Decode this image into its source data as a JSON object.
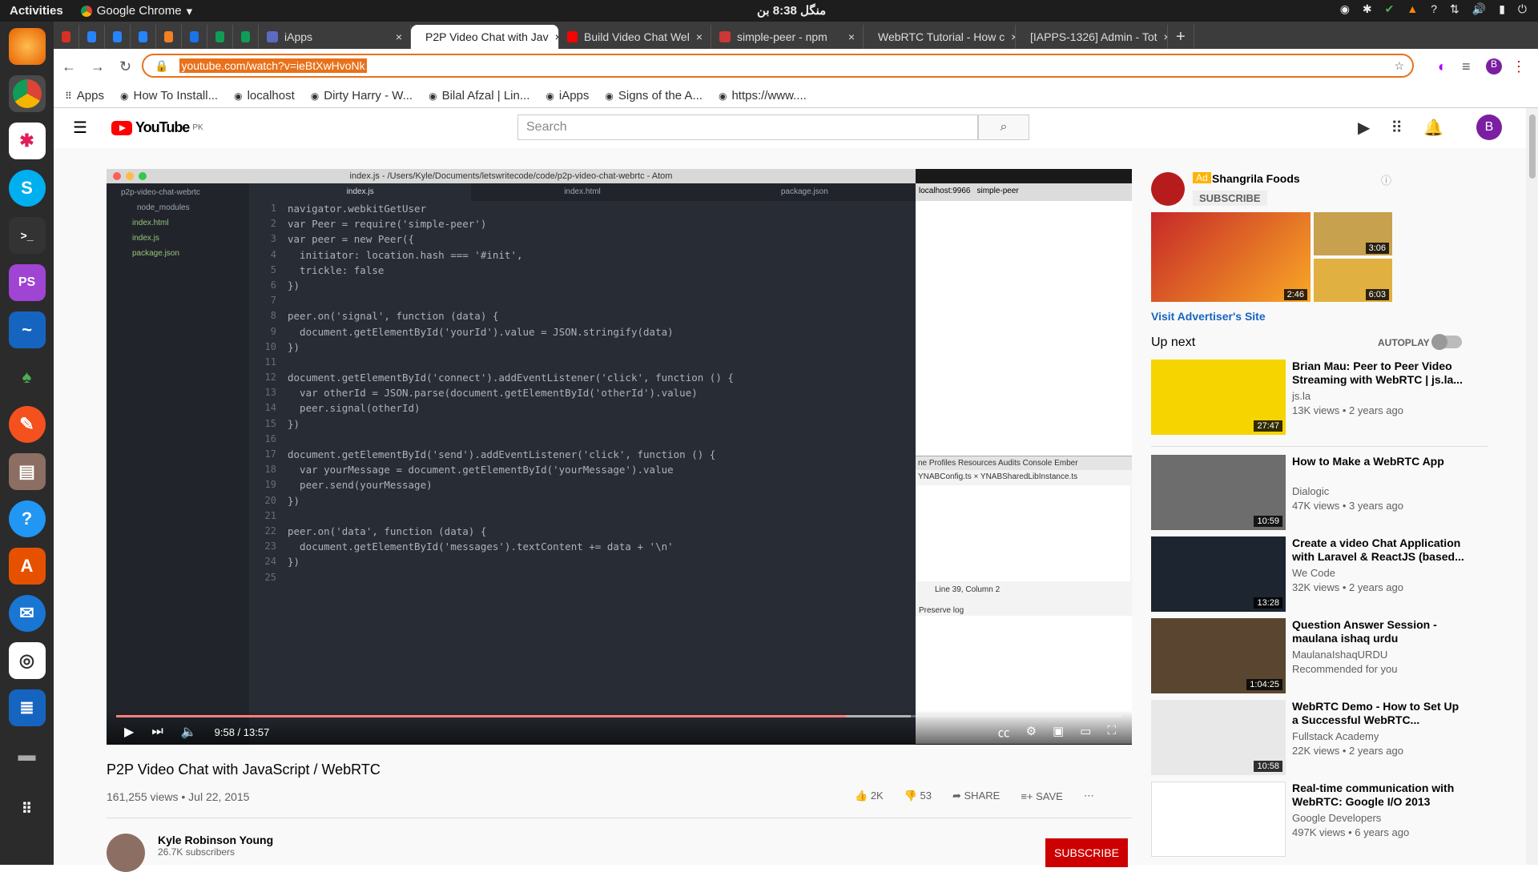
{
  "system": {
    "activities": "Activities",
    "app_name": "Google Chrome",
    "clock": "منگل 8:38 بن"
  },
  "dock": [
    "firefox",
    "chrome",
    "slack",
    "skype",
    "terminal",
    "phpstorm",
    "wireshark",
    "robomongo",
    "inkscape",
    "files",
    "help",
    "software-center",
    "thunderbird",
    "rhythmbox",
    "libreoffice-writer",
    "trash",
    "apps-grid"
  ],
  "tabs": [
    {
      "label": "",
      "icon": "gmail-icon"
    },
    {
      "label": "",
      "icon": "jira-icon"
    },
    {
      "label": "",
      "icon": "jira-icon"
    },
    {
      "label": "",
      "icon": "jira-icon"
    },
    {
      "label": "",
      "icon": "stackoverflow-icon"
    },
    {
      "label": "",
      "icon": "calendar-icon"
    },
    {
      "label": "",
      "icon": "sheets-icon"
    },
    {
      "label": "",
      "icon": "sheets-icon"
    },
    {
      "label": "iApps",
      "icon": "iapps-icon"
    },
    {
      "label": "P2P Video Chat with Jav",
      "icon": "youtube-icon",
      "active": true
    },
    {
      "label": "Build Video Chat Wel",
      "icon": "youtube-icon"
    },
    {
      "label": "simple-peer - npm",
      "icon": "npm-icon"
    },
    {
      "label": "WebRTC Tutorial - How c",
      "icon": "youtube-icon"
    },
    {
      "label": "[IAPPS-1326] Admin - Tot",
      "icon": "jira-icon"
    }
  ],
  "address": {
    "url": "youtube.com/watch?v=ieBtXwHvoNk"
  },
  "bookmarks": [
    "Apps",
    "How To Install...",
    "localhost",
    "Dirty Harry - W...",
    "Bilal Afzal | Lin...",
    "iApps",
    "Signs of the A...",
    "https://www...."
  ],
  "youtube": {
    "logo": "YouTube",
    "region": "PK",
    "search_placeholder": "Search",
    "avatar_letter": "B"
  },
  "atom": {
    "title": "index.js - /Users/Kyle/Documents/letswritecode/code/p2p-video-chat-webrtc - Atom",
    "tree": [
      "p2p-video-chat-webrtc",
      "node_modules",
      "index.html",
      "index.js",
      "package.json"
    ],
    "tabs": [
      "index.js",
      "index.html",
      "package.json"
    ],
    "lines": [
      "navigator.webkitGetUser",
      "var Peer = require('simple-peer')",
      "var peer = new Peer({",
      "  initiator: location.hash === '#init',",
      "  trickle: false",
      "})",
      "",
      "peer.on('signal', function (data) {",
      "  document.getElementById('yourId').value = JSON.stringify(data)",
      "})",
      "",
      "document.getElementById('connect').addEventListener('click', function () {",
      "  var otherId = JSON.parse(document.getElementById('otherId').value)",
      "  peer.signal(otherId)",
      "})",
      "",
      "document.getElementById('send').addEventListener('click', function () {",
      "  var yourMessage = document.getElementById('yourMessage').value",
      "  peer.send(yourMessage)",
      "})",
      "",
      "peer.on('data', function (data) {",
      "  document.getElementById('messages').textContent += data + '\\n'",
      "})",
      ""
    ],
    "browser_tabs": [
      "localhost:9966",
      "simple-peer"
    ],
    "devtools_tabs": "ne  Profiles  Resources  Audits  Console  Ember",
    "devtools_files": "YNABConfig.ts ×  YNABSharedLibInstance.ts",
    "devtools_status": "Line 39, Column 2",
    "preserve_log": "Preserve log"
  },
  "player": {
    "time": "9:58 / 13:57",
    "progress": 0.7255
  },
  "video": {
    "title": "P2P Video Chat with JavaScript / WebRTC",
    "meta": "161,255 views • Jul 22, 2015",
    "likes": "2K",
    "dislikes": "53",
    "share": "SHARE",
    "save": "SAVE",
    "channel": "Kyle Robinson Young",
    "subscribers": "26.7K subscribers",
    "subscribe": "SUBSCRIBE"
  },
  "ad": {
    "badge": "Ad",
    "name": "Shangrila Foods",
    "subscribe": "SUBSCRIBE",
    "d1": "2:46",
    "d2": "3:06",
    "d3": "6:03",
    "link": "Visit Advertiser's Site"
  },
  "upnext": {
    "label": "Up next",
    "autoplay": "AUTOPLAY"
  },
  "recs": [
    {
      "title": "Brian Mau: Peer to Peer Video Streaming with WebRTC | js.la...",
      "channel": "js.la",
      "views": "13K views • 2 years ago",
      "duration": "27:47",
      "color": "#f5d400"
    },
    {
      "title": "How to Make a WebRTC App",
      "channel": "Dialogic",
      "views": "47K views • 3 years ago",
      "duration": "10:59",
      "color": "#6d6d6d"
    },
    {
      "title": "Create a video Chat Application with Laravel & ReactJS (based...",
      "channel": "We Code",
      "views": "32K views • 2 years ago",
      "duration": "13:28",
      "color": "#1c2530"
    },
    {
      "title": "Question Answer Session - maulana ishaq urdu",
      "channel": "MaulanaIshaqURDU",
      "views": "Recommended for you",
      "duration": "1:04:25",
      "color": "#5a4630"
    },
    {
      "title": "WebRTC Demo - How to Set Up a Successful WebRTC...",
      "channel": "Fullstack Academy",
      "views": "22K views • 2 years ago",
      "duration": "10:58",
      "color": "#e8e8e8"
    },
    {
      "title": "Real-time communication with WebRTC: Google I/O 2013",
      "channel": "Google Developers",
      "views": "497K views • 6 years ago",
      "duration": "",
      "color": "#ffffff"
    }
  ]
}
